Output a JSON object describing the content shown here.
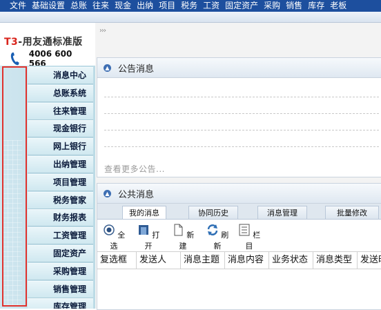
{
  "menu": [
    "文件",
    "基础设置",
    "总账",
    "往来",
    "现金",
    "出纳",
    "项目",
    "税务",
    "工资",
    "固定资产",
    "采购",
    "销售",
    "库存",
    "老板"
  ],
  "brand": {
    "prefix": "T3",
    "title": "-用友通标准版",
    "phone": "4006 600 566"
  },
  "nav": [
    "消息中心",
    "总账系统",
    "往来管理",
    "现金银行",
    "网上银行",
    "出纳管理",
    "项目管理",
    "税务管家",
    "财务报表",
    "工资管理",
    "固定资产",
    "采购管理",
    "销售管理",
    "库存管理"
  ],
  "toggle_symbol": "›››",
  "announcement": {
    "title": "公告消息",
    "more": "查看更多公告..."
  },
  "public": {
    "title": "公共消息",
    "tabs": [
      "我的消息",
      "协同历史",
      "消息管理",
      "批量修改"
    ],
    "toolbar": [
      "全选",
      "打开",
      "新建",
      "刷新",
      "栏目"
    ],
    "columns": [
      "复选框",
      "发送人",
      "消息主题",
      "消息内容",
      "业务状态",
      "消息类型",
      "发送时间"
    ]
  },
  "colors": {
    "menubar": "#1d4f9e",
    "highlight": "#e0312c",
    "nav_bg": "#cfe6ef"
  }
}
